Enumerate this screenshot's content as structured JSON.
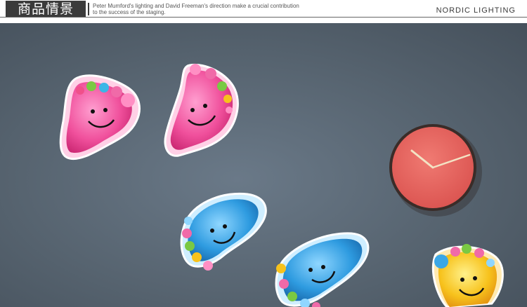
{
  "header": {
    "title": "商品情景",
    "subtitle": "Peter Mumford's lighting and David Freeman's direction make a crucial contribution to the success of the staging.",
    "brand": "NORDIC LIGHTING"
  },
  "colors": {
    "wall": "#56636f",
    "pink_foot": "#f06aa8",
    "blue_foot": "#3ba7e6",
    "yellow_foot": "#f7c21c",
    "clock_face": "#e9605c",
    "clock_hands": "#f3e2c4"
  }
}
